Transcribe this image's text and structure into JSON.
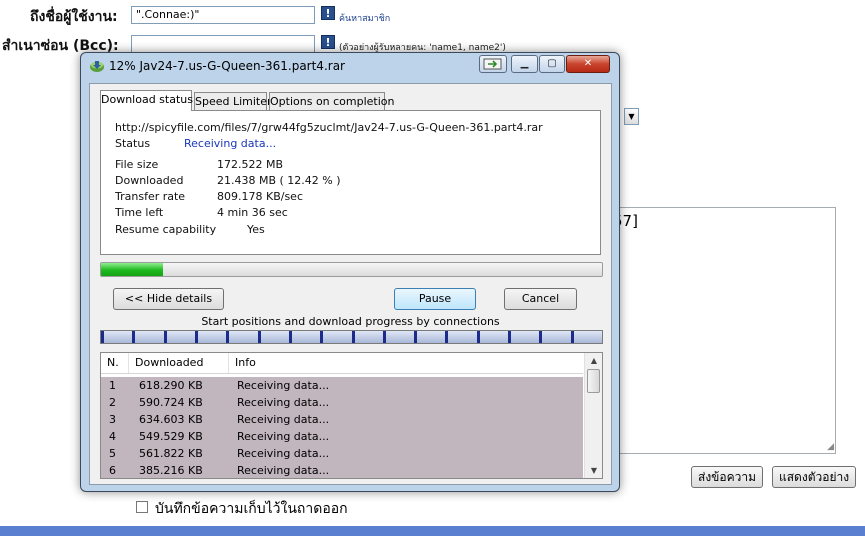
{
  "web_form": {
    "to_user_label": "ถึงชื่อผู้ใช้งาน:",
    "to_user_value": "\".Connae:)\"",
    "find_member_link": "ค้นหาสมาชิก",
    "bcc_label": "สำเนาซ่อน (Bcc):",
    "bcc_hint": "(ตัวอย่างผู้รับหลายคน: 'name1, name2')",
    "textarea_fragment": "57]",
    "send_button": "ส่งข้อความ",
    "preview_button": "แสดงตัวอย่าง",
    "save_copy_label": "บันทึกข้อความเก็บไว้ในถาดออก",
    "info_icon_glyph": "!"
  },
  "window": {
    "title": "12% Jav24-7.us-G-Queen-361.part4.rar",
    "tabs": [
      "Download status",
      "Speed Limiter",
      "Options on completion"
    ],
    "url": "http://spicyfile.com/files/7/grw44fg5zuclmt/Jav24-7.us-G-Queen-361.part4.rar",
    "status_label": "Status",
    "status_value": "Receiving data...",
    "file_size_label": "File size",
    "file_size_value": "172.522  MB",
    "downloaded_label": "Downloaded",
    "downloaded_value": "21.438  MB  ( 12.42 % )",
    "transfer_rate_label": "Transfer rate",
    "transfer_rate_value": "809.178  KB/sec",
    "time_left_label": "Time left",
    "time_left_value": "4 min 36 sec",
    "resume_label": "Resume capability",
    "resume_value": "Yes",
    "progress_percent": 12.42,
    "buttons": {
      "hide_details": "<< Hide details",
      "pause": "Pause",
      "cancel": "Cancel"
    },
    "connections_caption": "Start positions and download progress by connections",
    "list_headers": [
      "N.",
      "Downloaded",
      "Info"
    ],
    "connections": [
      {
        "n": "1",
        "downloaded": "618.290  KB",
        "info": "Receiving data..."
      },
      {
        "n": "2",
        "downloaded": "590.724  KB",
        "info": "Receiving data..."
      },
      {
        "n": "3",
        "downloaded": "634.603  KB",
        "info": "Receiving data..."
      },
      {
        "n": "4",
        "downloaded": "549.529  KB",
        "info": "Receiving data..."
      },
      {
        "n": "5",
        "downloaded": "561.822  KB",
        "info": "Receiving data..."
      },
      {
        "n": "6",
        "downloaded": "385.216  KB",
        "info": "Receiving data..."
      }
    ]
  },
  "colors": {
    "progress_green": "#1fb81f",
    "row_highlight": "#c1b5be",
    "status_blue": "#1a37b8",
    "page_bottom_bar": "#5b7fd0"
  }
}
